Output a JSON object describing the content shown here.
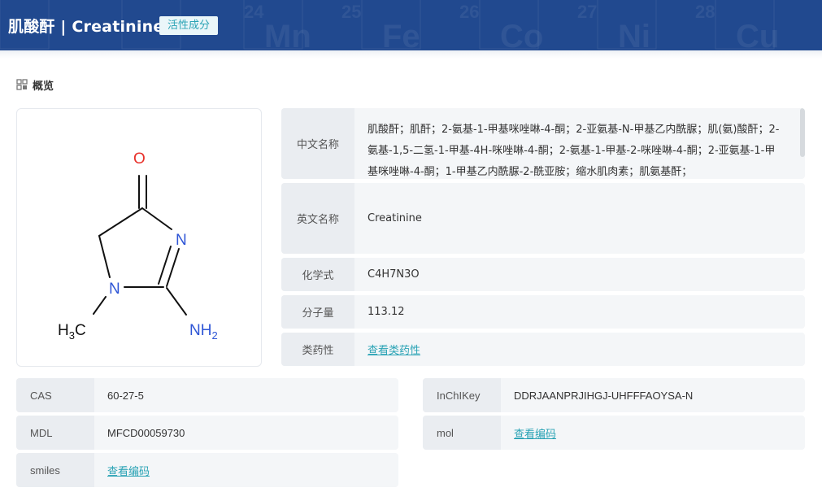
{
  "header": {
    "title": "肌酸酐 | Creatinine",
    "badge": "活性成分",
    "bg_color": "#21498f"
  },
  "section": {
    "icon": "grid-icon",
    "title": "概览"
  },
  "structure": {
    "atoms": {
      "o": "O",
      "n1": "N",
      "n2": "N",
      "ch3": "H3C",
      "nh2": "NH2"
    }
  },
  "info": {
    "chinese_name": {
      "label": "中文名称",
      "value": "肌酸酐；肌酐；2-氨基-1-甲基咪唑啉-4-酮；2-亚氨基-N-甲基乙内酰脲；肌(氨)酸酐；2-氨基-1,5-二氢-1-甲基-4H-咪唑啉-4-酮；2-氨基-1-甲基-2-咪唑啉-4-酮；2-亚氨基-1-甲基咪唑啉-4-酮；1-甲基乙内酰脲-2-酰亚胺；缩水肌肉素；肌氨基酐；"
    },
    "english_name": {
      "label": "英文名称",
      "value": "Creatinine"
    },
    "formula": {
      "label": "化学式",
      "value": "C4H7N3O"
    },
    "mw": {
      "label": "分子量",
      "value": "113.12"
    },
    "drug_class": {
      "label": "类药性",
      "value": "查看类药性"
    }
  },
  "grid": {
    "cas": {
      "label": "CAS",
      "value": "60-27-5"
    },
    "inchikey": {
      "label": "InChIKey",
      "value": "DDRJAANPRJIHGJ-UHFFFAOYSA-N"
    },
    "mdl": {
      "label": "MDL",
      "value": "MFCD00059730"
    },
    "mol": {
      "label": "mol",
      "value": "查看编码"
    },
    "smiles": {
      "label": "smiles",
      "value": "查看编码"
    }
  },
  "colors": {
    "accent": "#2aa3b5",
    "oxygen": "#e8312a",
    "nitrogen": "#2f56d6"
  }
}
